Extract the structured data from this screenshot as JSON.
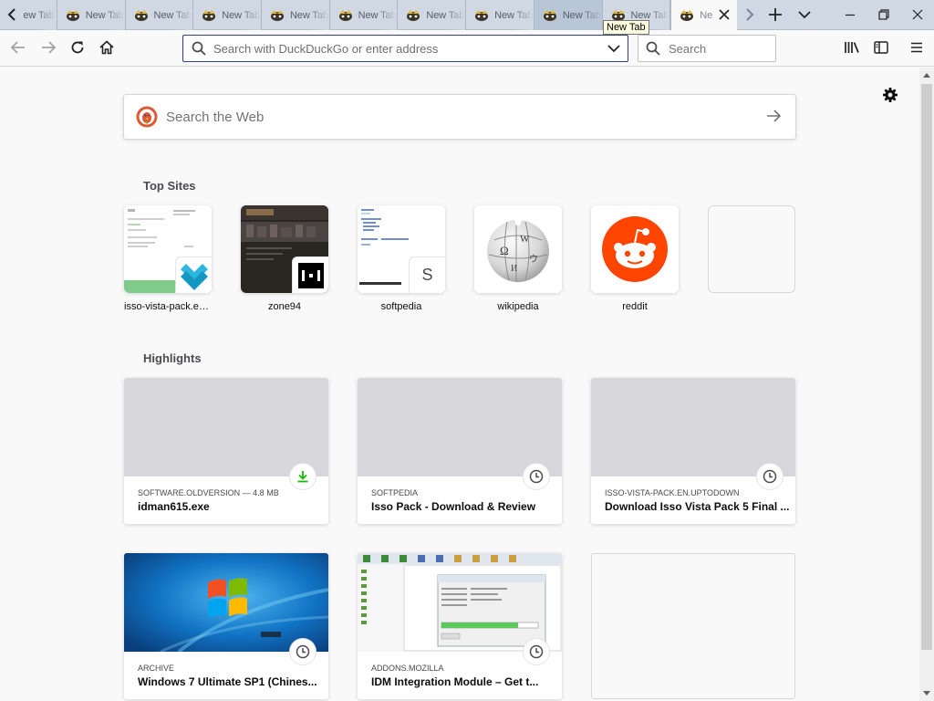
{
  "tab_strip": {
    "tabs": [
      {
        "label": "New Tab",
        "state": "partial"
      },
      {
        "label": "New Tab",
        "state": "normal"
      },
      {
        "label": "New Tab",
        "state": "normal"
      },
      {
        "label": "New Tab",
        "state": "normal"
      },
      {
        "label": "New Tab",
        "state": "normal"
      },
      {
        "label": "New Tab",
        "state": "normal"
      },
      {
        "label": "New Tab",
        "state": "normal"
      },
      {
        "label": "New Tab",
        "state": "normal"
      },
      {
        "label": "New Tab",
        "state": "hover"
      },
      {
        "label": "New Tab",
        "state": "normal"
      },
      {
        "label": "New Tab",
        "state": "selected"
      }
    ],
    "icons": {
      "scroll_left": "chevron-left-icon",
      "scroll_right": "chevron-right-icon",
      "new_tab": "plus-icon",
      "list_all_tabs": "chevron-down-icon",
      "minimize": "minimize-icon",
      "restore": "restore-icon",
      "close": "close-icon"
    },
    "tooltip": "New Tab"
  },
  "navbar": {
    "url_placeholder": "Search with DuckDuckGo or enter address",
    "search_placeholder": "Search",
    "icons": [
      "back-icon",
      "forward-icon",
      "reload-icon",
      "home-icon",
      "library-icon",
      "sidebar-icon",
      "menu-icon"
    ]
  },
  "newtab": {
    "search_placeholder": "Search the Web",
    "top_sites_title": "Top Sites",
    "top_sites": [
      {
        "label": "isso-vista-pack.en..."
      },
      {
        "label": "zone94"
      },
      {
        "label": "softpedia"
      },
      {
        "label": "wikipedia"
      },
      {
        "label": "reddit"
      },
      {
        "label": ""
      }
    ],
    "softpedia_badge_letter": "S",
    "highlights_title": "Highlights",
    "highlights": [
      {
        "context": "SOFTWARE.OLDVERSION — 4.8 MB",
        "title": "idman615.exe",
        "icon": "download-icon"
      },
      {
        "context": "SOFTPEDIA",
        "title": "Isso Pack - Download & Review",
        "icon": "clock-icon"
      },
      {
        "context": "ISSO-VISTA-PACK.EN.UPTODOWN",
        "title": "Download Isso Vista Pack 5 Final ...",
        "icon": "clock-icon"
      },
      {
        "context": "ARCHIVE",
        "title": "Windows 7 Ultimate SP1 (Chines...",
        "icon": "clock-icon"
      },
      {
        "context": "ADDONS.MOZILLA",
        "title": "IDM Integration Module – Get t...",
        "icon": "clock-icon"
      }
    ]
  },
  "colors": {
    "tab_strip_bg": "#cfd8e3",
    "page_bg": "#f9f9fa",
    "reddit": "#ff4500",
    "download_green": "#12bc00",
    "windows_blue": "#1173c4"
  }
}
